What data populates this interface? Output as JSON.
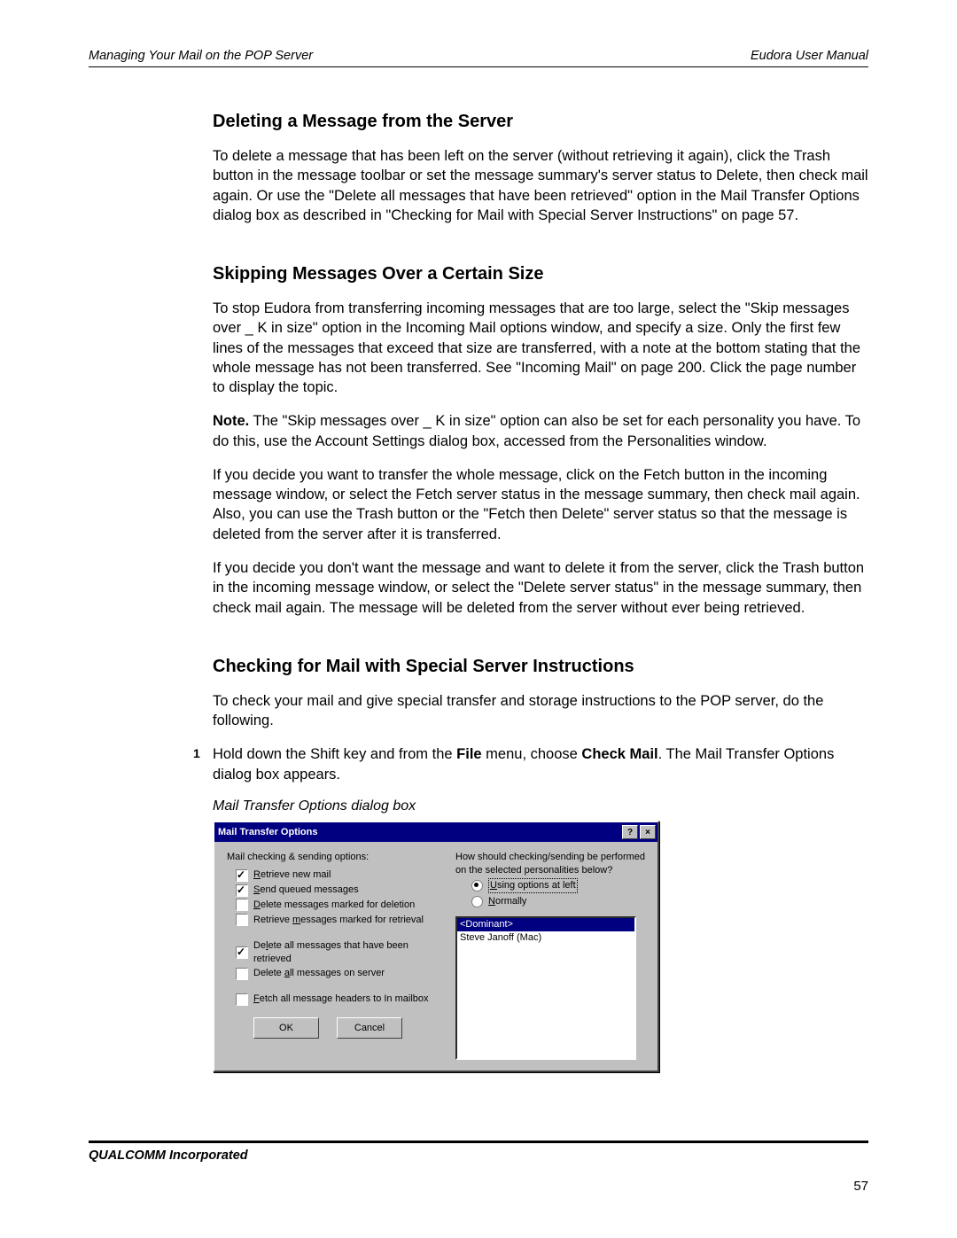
{
  "header": {
    "left": "Managing Your Mail on the POP Server",
    "right": "Eudora User Manual"
  },
  "sections": {
    "s1": {
      "title": "Deleting a Message from the Server",
      "p1": "To delete a message that has been left on the server (without retrieving it again), click the Trash button in the message toolbar or set the message summary's server status to Delete, then check mail again. Or use the \"Delete all messages that have been retrieved\" option in the Mail Transfer Options dialog box as described in \"Checking for Mail with Special Server Instructions\" on page 57."
    },
    "s2": {
      "title": "Skipping Messages Over a Certain Size",
      "p1": "To stop Eudora from transferring incoming messages that are too large, select the \"Skip messages over _ K in size\" option in the Incoming Mail options window, and specify a size. Only the first few lines of the messages that exceed that size are transferred, with a note at the bottom stating that the whole message has not been transferred. See \"Incoming Mail\" on page 200. Click the page number to display the topic.",
      "note_label": "Note.",
      "note_body": " The \"Skip messages over _ K in size\" option can also be set for each personality you have. To do this, use the Account Settings dialog box, accessed from the Personalities window.",
      "p3": "If you decide you want to transfer the whole message, click on the Fetch button in the incoming message window, or select the Fetch server status in the message summary, then check mail again. Also, you can use the Trash button or the \"Fetch then Delete\" server status so that the message is deleted from the server after it is transferred.",
      "p4": "If you decide you don't want the message and want to delete it from the server, click the Trash button in the incoming message window, or select the \"Delete server status\" in the message summary, then check mail again. The message will be deleted from the server without ever being retrieved."
    },
    "s3": {
      "title": "Checking for Mail with Special Server Instructions",
      "intro": "To check your mail and give special transfer and storage instructions to the POP server, do the following.",
      "step1_pre": "Hold down the Shift key and from the ",
      "step1_bold1": "File",
      "step1_mid": " menu, choose ",
      "step1_bold2": "Check Mail",
      "step1_post": ". The Mail Transfer Options dialog box appears.",
      "caption": "Mail Transfer Options dialog box"
    }
  },
  "dialog": {
    "title": "Mail Transfer Options",
    "help": "?",
    "close": "×",
    "left_label": "Mail checking & sending options:",
    "opts": {
      "retrieve": "Retrieve new mail",
      "send": "Send queued messages",
      "delete_marked": "Delete messages marked for deletion",
      "retrieve_marked": "Retrieve messages marked for retrieval",
      "delete_retrieved": "Delete all messages that have been retrieved",
      "delete_all": "Delete all messages on server",
      "fetch_headers": "Fetch all message headers to In mailbox"
    },
    "right_label1": "How should checking/sending be performed",
    "right_label2": "on the selected personalities below?",
    "radio_using": "Using options at left",
    "radio_normally": "Normally",
    "list": {
      "dominant": "<Dominant>",
      "item2": "Steve Janoff (Mac)"
    },
    "ok": "OK",
    "cancel": "Cancel"
  },
  "footer": {
    "company": "QUALCOMM Incorporated",
    "page": "57"
  }
}
